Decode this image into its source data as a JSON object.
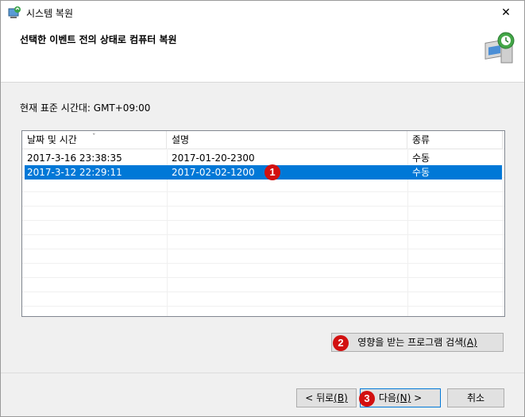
{
  "window": {
    "title": "시스템 복원",
    "close_glyph": "✕",
    "header_title": "선택한 이벤트 전의 상태로 컴퓨터 복원",
    "timezone_label": "현재 표준 시간대: GMT+09:00"
  },
  "table": {
    "columns": [
      "날짜 및 시간",
      "설명",
      "종류"
    ],
    "rows": [
      [
        "2017-3-16 23:38:35",
        "2017-01-20-2300",
        "수동"
      ],
      [
        "2017-3-12 22:29:11",
        "2017-02-02-1200",
        "수동"
      ]
    ],
    "selected_row": 1
  },
  "buttons": {
    "scan_label": "영향을 받는 프로그램 검색",
    "scan_key": "(A)",
    "back_label": "< 뒤로",
    "back_key": "(B)",
    "next_label": "다음",
    "next_key": "(N)",
    "next_suffix": " >",
    "cancel_label": "취소"
  },
  "badges": [
    "1",
    "2",
    "3"
  ],
  "colors": {
    "selection": "#0078d7",
    "badge": "#d21010"
  }
}
